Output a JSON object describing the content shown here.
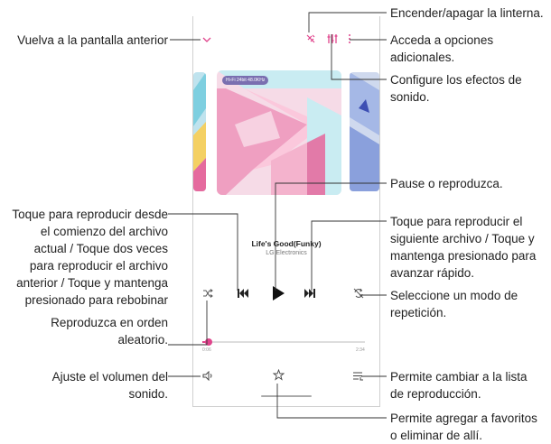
{
  "player": {
    "badge": "Hi-Fi  24bit 48.0KHz",
    "song_title": "Life's Good(Funky)",
    "artist": "LG Electronics",
    "time_elapsed": "0:06",
    "time_total": "2:34",
    "progress": 0.038
  },
  "icons": [
    "chevron-down-icon",
    "flashlight-icon",
    "equalizer-icon",
    "more-vertical-icon",
    "shuffle-icon",
    "previous-icon",
    "play-icon",
    "next-icon",
    "repeat-icon",
    "volume-icon",
    "favorite-star-icon",
    "playlist-icon"
  ],
  "colors": {
    "accent": "#e0448c",
    "line": "#333333"
  },
  "callouts": {
    "back": "Vuelva a la pantalla anterior",
    "flashlight": "Encender/apagar la linterna.",
    "options_1": "Acceda a opciones",
    "options_2": "adicionales.",
    "sound_1": "Configure los efectos de",
    "sound_2": "sonido.",
    "pause": "Pause o reproduzca.",
    "prev_1": "Toque para reproducir desde",
    "prev_2": "el comienzo del archivo",
    "prev_3": "actual / Toque dos veces",
    "prev_4": "para reproducir el archivo",
    "prev_5": "anterior / Toque y mantenga",
    "prev_6": "presionado para rebobinar",
    "next_1": "Toque para reproducir el",
    "next_2": "siguiente archivo / Toque y",
    "next_3": "mantenga presionado para",
    "next_4": "avanzar rápido.",
    "repeat_1": "Seleccione un modo de",
    "repeat_2": "repetición.",
    "shuffle_1": "Reproduzca en orden",
    "shuffle_2": "aleatorio.",
    "volume_1": "Ajuste el volumen del",
    "volume_2": "sonido.",
    "playlist_1": "Permite cambiar a la lista",
    "playlist_2": "de reproducción.",
    "favorite_1": "Permite agregar a favoritos",
    "favorite_2": "o eliminar de allí."
  }
}
